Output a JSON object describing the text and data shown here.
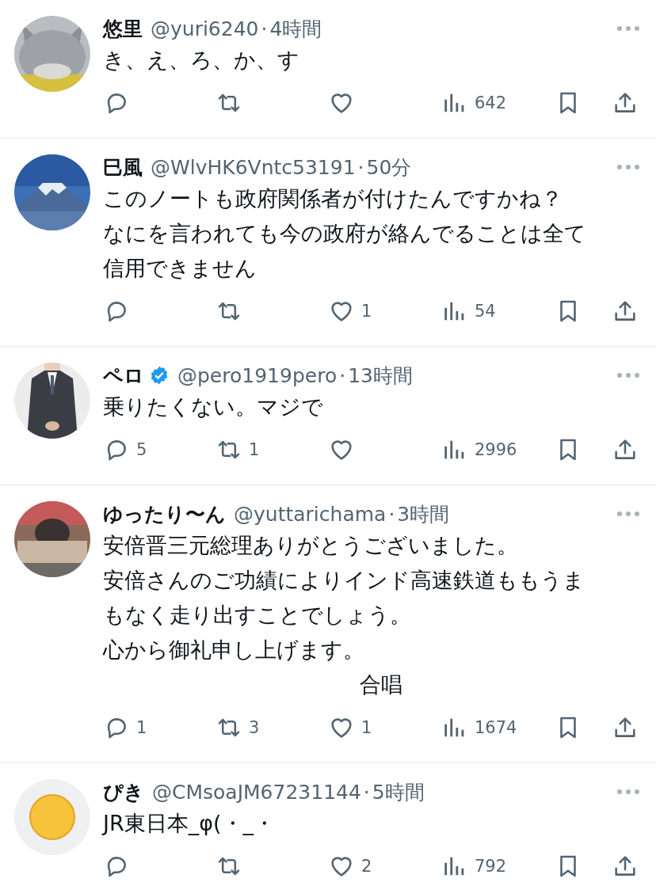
{
  "tweets": [
    {
      "name": "悠里",
      "verified": false,
      "handle": "@yuri6240",
      "separator": "·",
      "time": "4時間",
      "lines": [
        "き、え、ろ、か、す"
      ],
      "counts": {
        "views": "642"
      }
    },
    {
      "name": "巳風",
      "verified": false,
      "handle": "@WlvHK6Vntc53191",
      "separator": "·",
      "time": "50分",
      "lines": [
        "このノートも政府関係者が付けたんですかね？",
        "なにを言われても今の政府が絡んでることは全て",
        "信用できません"
      ],
      "counts": {
        "likes": "1",
        "views": "54"
      }
    },
    {
      "name": "ペロ",
      "verified": true,
      "handle": "@pero1919pero",
      "separator": "·",
      "time": "13時間",
      "lines": [
        "乗りたくない。マジで"
      ],
      "counts": {
        "replies": "5",
        "retweets": "1",
        "views": "2996"
      }
    },
    {
      "name": "ゆったり〜ん",
      "verified": false,
      "handle": "@yuttarichama",
      "separator": "·",
      "time": "3時間",
      "lines": [
        "安倍晋三元総理ありがとうございました。",
        "安倍さんのご功績によりインド高速鉄道ももうま",
        "もなく走り出すことでしょう。",
        "心から御礼申し上げます。",
        "　　　　　　　　　　　　合唱"
      ],
      "counts": {
        "replies": "1",
        "retweets": "3",
        "likes": "1",
        "views": "1674"
      }
    },
    {
      "name": "ぴき",
      "verified": false,
      "handle": "@CMsoaJM67231144",
      "separator": "·",
      "time": "5時間",
      "lines": [
        "JR東日本_φ(・_・"
      ],
      "counts": {
        "likes": "2",
        "views": "792"
      }
    }
  ]
}
